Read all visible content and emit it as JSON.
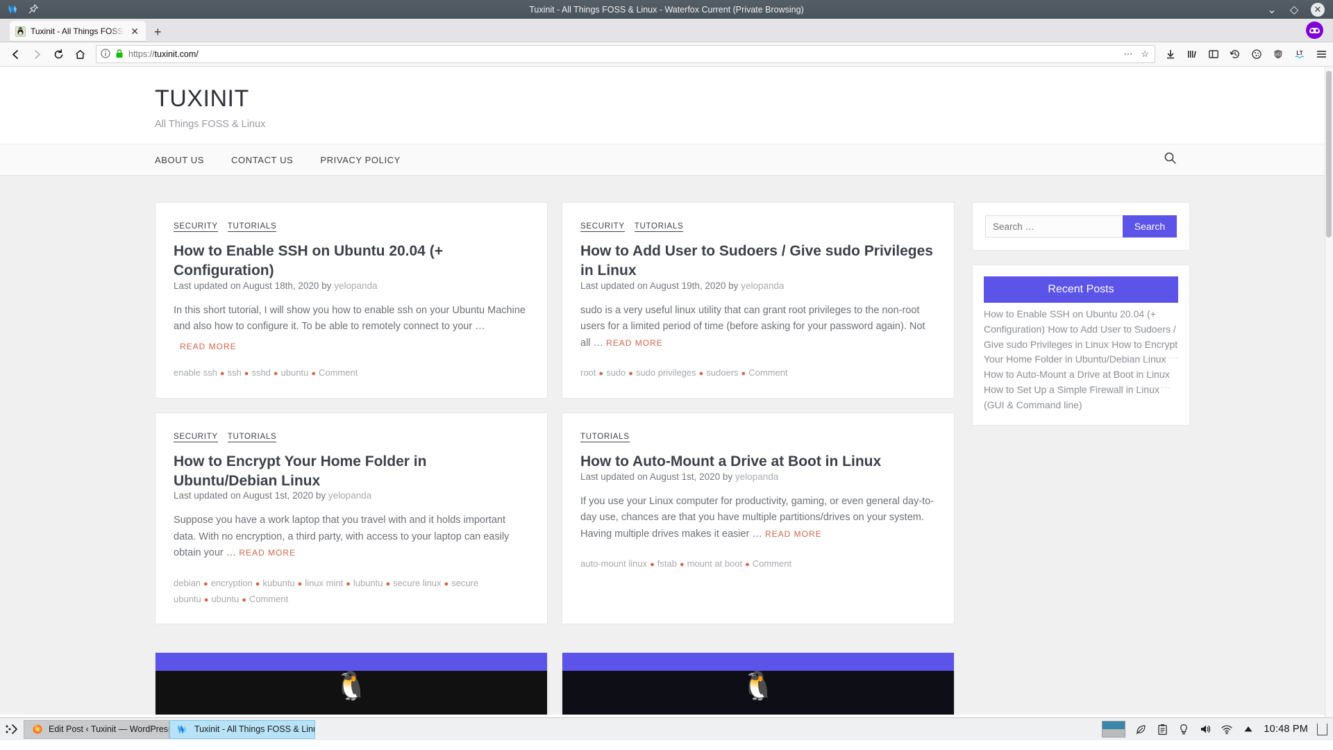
{
  "window": {
    "title": "Tuxinit - All Things FOSS & Linux - Waterfox Current (Private Browsing)",
    "minimize_label": "⌄",
    "restore_label": "◇",
    "close_label": "✕"
  },
  "tabs": {
    "items": [
      {
        "label": "Tuxinit - All Things FOSS & Linux",
        "favicon": "tux-favicon",
        "close_label": "✕"
      }
    ],
    "new_tab_label": "+",
    "private_badge": "private-browsing-mask-icon"
  },
  "toolbar": {
    "back_label": "←",
    "forward_label": "→",
    "reload_label": "↻",
    "home_label": "⌂",
    "identity_label": "ⓘ",
    "lock_label": "lock-icon",
    "url_protocol": "https://",
    "url_host": "tuxinit.com",
    "url_path": "/",
    "page_actions_label": "⋯",
    "bookmark_label": "☆",
    "icons": [
      "downloads-icon",
      "library-icon",
      "sidebar-icon",
      "history-icon",
      "cookie-icon",
      "ublock-origin-icon",
      "languagetool-icon",
      "menu-icon"
    ]
  },
  "site": {
    "title": "TUXINIT",
    "tagline": "All Things FOSS & Linux",
    "nav": [
      {
        "label": "About Us"
      },
      {
        "label": "Contact Us"
      },
      {
        "label": "Privacy Policy"
      }
    ],
    "search_icon": "search-icon"
  },
  "posts": [
    {
      "categories": [
        "Security",
        "Tutorials"
      ],
      "title": "How to Enable SSH on Ubuntu 20.04 (+ Configuration)",
      "meta_prefix": "Last updated on August 18th, 2020 by ",
      "author": "yelopanda",
      "excerpt": "In this short tutorial, I will show you how to enable ssh on your Ubuntu Machine and also how to configure it. To be able to remotely connect to your …",
      "read_more": "Read More",
      "read_more_inline": false,
      "tags": [
        "enable ssh",
        "ssh",
        "sshd",
        "ubuntu"
      ],
      "comment_label": "Comment"
    },
    {
      "categories": [
        "Security",
        "Tutorials"
      ],
      "title": "How to Add User to Sudoers / Give sudo Privileges in Linux",
      "meta_prefix": "Last updated on August 19th, 2020 by ",
      "author": "yelopanda",
      "excerpt": "sudo is a very useful linux utility that can grant root privileges to the non-root users for a limited period of time (before asking for your password again). Not all …",
      "read_more": "Read More",
      "read_more_inline": true,
      "tags": [
        "root",
        "sudo",
        "sudo privileges",
        "sudoers"
      ],
      "comment_label": "Comment"
    },
    {
      "categories": [
        "Security",
        "Tutorials"
      ],
      "title": "How to Encrypt Your Home Folder in Ubuntu/Debian Linux",
      "meta_prefix": "Last updated on August 1st, 2020 by ",
      "author": "yelopanda",
      "excerpt": "Suppose you have a work laptop that you travel with and it holds important data. With no encryption, a third party, with access to your laptop can easily obtain your …",
      "read_more": "Read More",
      "read_more_inline": true,
      "tags": [
        "debian",
        "encryption",
        "kubuntu",
        "linux mint",
        "lubuntu",
        "secure linux",
        "secure ubuntu",
        "ubuntu"
      ],
      "comment_label": "Comment"
    },
    {
      "categories": [
        "Tutorials"
      ],
      "title": "How to Auto-Mount a Drive at Boot in Linux",
      "meta_prefix": "Last updated on August 1st, 2020 by ",
      "author": "yelopanda",
      "excerpt": "If you use your Linux computer for productivity, gaming, or even general day-to-day use, chances are that you have multiple partitions/drives on your system. Having multiple drives makes it easier …",
      "read_more": "Read More",
      "read_more_inline": true,
      "tags": [
        "auto-mount linux",
        "fstab",
        "mount at boot"
      ],
      "comment_label": "Comment"
    }
  ],
  "sidebar": {
    "search": {
      "placeholder": "Search …",
      "value": "",
      "button_label": "Search"
    },
    "recent_posts": {
      "title": "Recent Posts",
      "items": [
        "How to Enable SSH on Ubuntu 20.04 (+ Configuration)",
        "How to Add User to Sudoers / Give sudo Privileges in Linux",
        "How to Encrypt Your Home Folder in Ubuntu/Debian Linux",
        "How to Auto-Mount a Drive at Boot in Linux",
        "How to Set Up a Simple Firewall in Linux (GUI & Command line)"
      ]
    }
  },
  "colors": {
    "accent_purple": "#5c53e8",
    "read_more_red": "#d2644b",
    "heading": "#3c4049",
    "muted": "#8c8f94"
  },
  "taskbar": {
    "menu_label": "⋮❯",
    "windows": [
      {
        "label": "Edit Post ‹ Tuxinit — WordPress - …",
        "icon": "firefox-icon",
        "active": false
      },
      {
        "label": "Tuxinit - All Things FOSS & Linux - …",
        "icon": "waterfox-icon",
        "active": true
      }
    ],
    "tray_icons": [
      "workspace-switcher",
      "leaf-icon",
      "clipboard-icon",
      "bulb-icon",
      "volume-icon",
      "wifi-icon",
      "expand-icon"
    ],
    "clock": "10:48 PM",
    "show_desktop": "show-desktop-icon"
  }
}
